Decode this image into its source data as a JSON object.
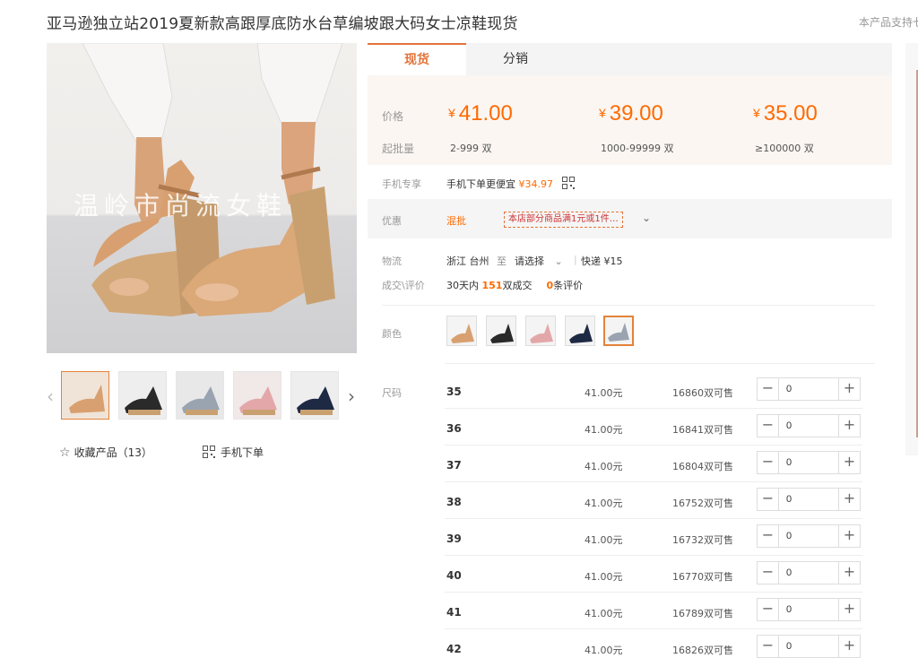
{
  "product": {
    "title": "亚马逊独立站2019夏新款高跟厚底防水台草编坡跟大码女士凉鞋现货",
    "support_note": "本产品支持七",
    "watermark": "温岭市尚流女鞋"
  },
  "actions": {
    "favorite_label": "收藏产品（13）",
    "mobile_order_label": "手机下单"
  },
  "tabs": [
    {
      "label": "现货",
      "active": true
    },
    {
      "label": "分销",
      "active": false
    }
  ],
  "pricing": {
    "price_label": "价格",
    "batch_label": "起批量",
    "currency": "¥",
    "tiers": [
      {
        "price": "41.00",
        "range": "2-999",
        "unit": "双"
      },
      {
        "price": "39.00",
        "range": "1000-99999",
        "unit": "双"
      },
      {
        "price": "35.00",
        "range": "≥100000",
        "unit": "双"
      }
    ]
  },
  "mobile": {
    "label": "手机专享",
    "text": "手机下单更便宜",
    "price": "¥34.97"
  },
  "promo": {
    "label": "优惠",
    "type": "混批",
    "badge": "本店部分商品满1元或1件…"
  },
  "logistics": {
    "label": "物流",
    "origin": "浙江 台州",
    "to": "至",
    "select": "请选择",
    "express": "快递 ¥15"
  },
  "sales": {
    "label": "成交\\评价",
    "prefix": "30天内",
    "count": "151",
    "count_suffix": "双成交",
    "reviews": "0",
    "reviews_suffix": "条评价"
  },
  "colors": {
    "label": "颜色",
    "selected_index": 4
  },
  "sizes": {
    "label": "尺码",
    "rows": [
      {
        "size": "35",
        "price": "41.00元",
        "stock": "16860双可售",
        "qty": "0"
      },
      {
        "size": "36",
        "price": "41.00元",
        "stock": "16841双可售",
        "qty": "0"
      },
      {
        "size": "37",
        "price": "41.00元",
        "stock": "16804双可售",
        "qty": "0"
      },
      {
        "size": "38",
        "price": "41.00元",
        "stock": "16752双可售",
        "qty": "0"
      },
      {
        "size": "39",
        "price": "41.00元",
        "stock": "16732双可售",
        "qty": "0"
      },
      {
        "size": "40",
        "price": "41.00元",
        "stock": "16770双可售",
        "qty": "0"
      },
      {
        "size": "41",
        "price": "41.00元",
        "stock": "16789双可售",
        "qty": "0"
      },
      {
        "size": "42",
        "price": "41.00元",
        "stock": "16826双可售",
        "qty": "0"
      }
    ]
  },
  "theme": {
    "accent": "#ff6a00",
    "tab_accent": "#e4733a"
  }
}
